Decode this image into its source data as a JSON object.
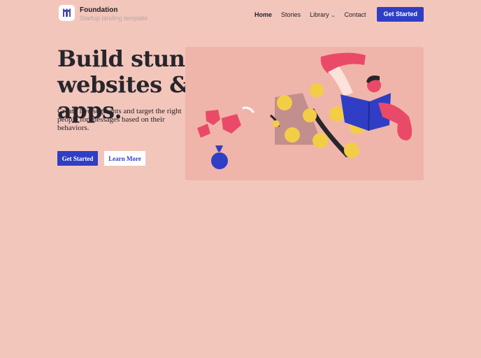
{
  "brand": {
    "name": "Foundation",
    "tagline": "Startup landing template"
  },
  "nav": {
    "items": [
      {
        "label": "Home",
        "active": true
      },
      {
        "label": "Stories"
      },
      {
        "label": "Library",
        "has_dropdown": true
      },
      {
        "label": "Contact"
      }
    ],
    "cta": "Get Started"
  },
  "hero": {
    "title": "Build stunning websites & apps.",
    "subtitle": "Create live segments and target the right people for messages based on their behaviors.",
    "primary_button": "Get Started",
    "secondary_button": "Learn More"
  },
  "colors": {
    "background": "#f3c6bc",
    "primary": "#2f3ec4",
    "panel": "#efb5aa",
    "accent_pink": "#ea4a68",
    "accent_yellow": "#f4cd46"
  }
}
